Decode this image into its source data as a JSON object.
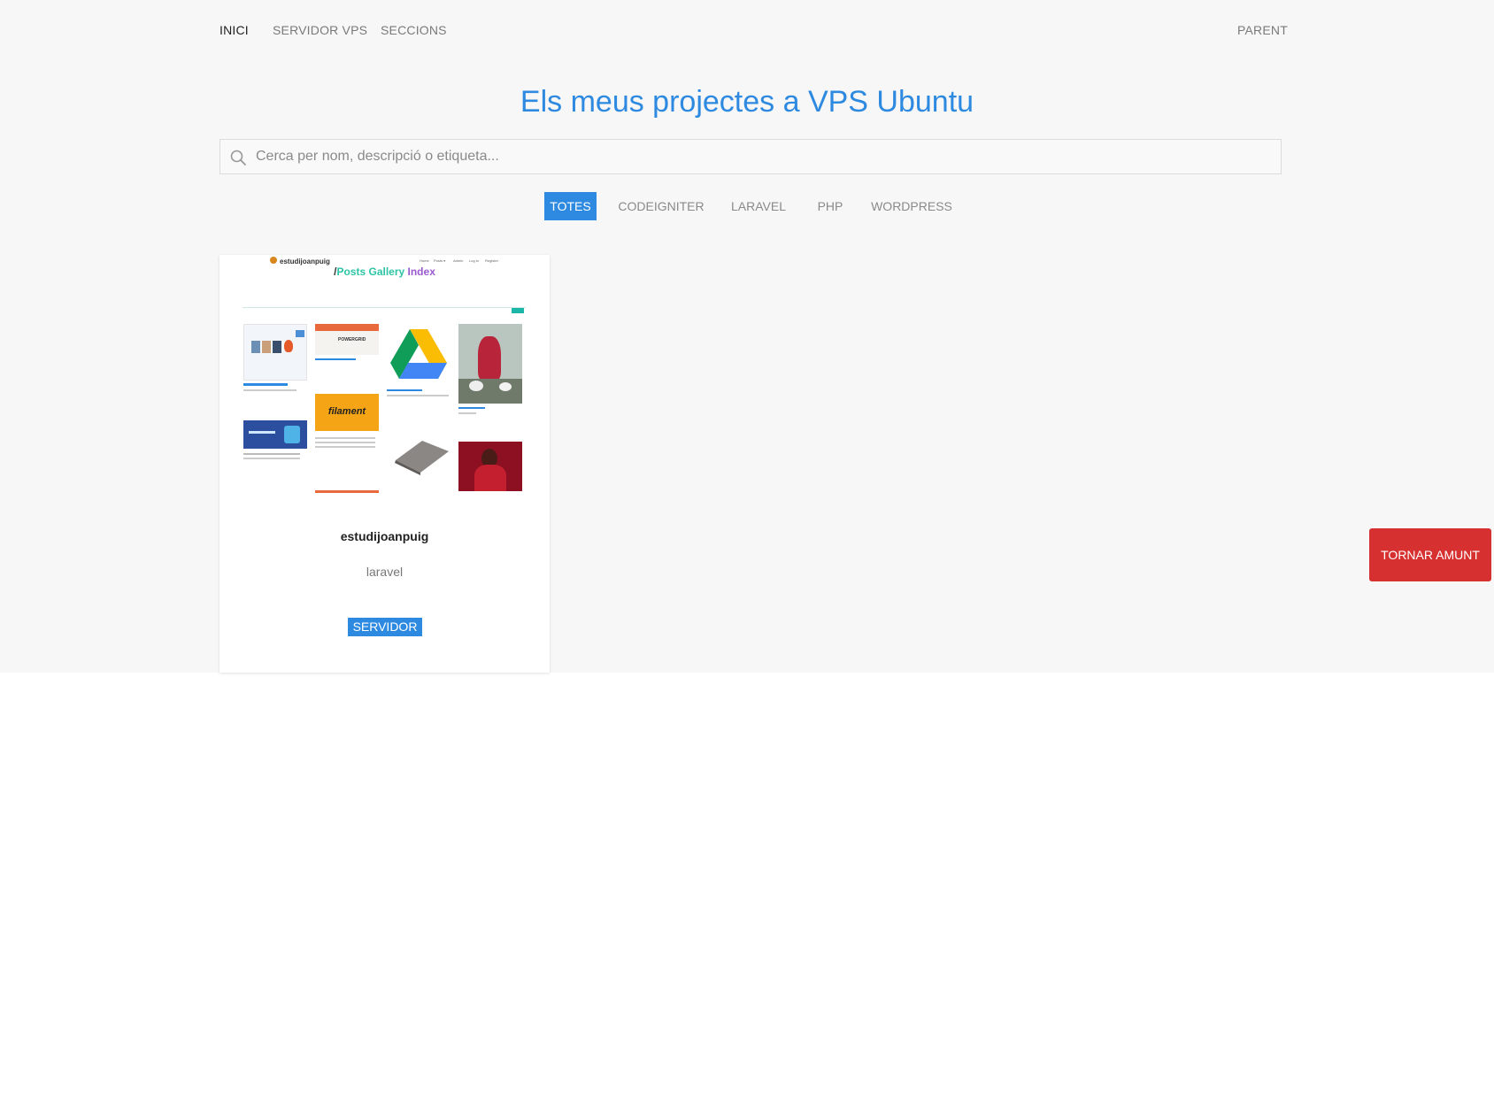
{
  "nav": {
    "items": [
      {
        "label": "INICI",
        "active": true
      },
      {
        "label": "SERVIDOR VPS",
        "active": false
      },
      {
        "label": "SECCIONS",
        "active": false
      }
    ],
    "right_label": "PARENT"
  },
  "page_title": "Els meus projectes a VPS Ubuntu",
  "search": {
    "placeholder": "Cerca per nom, descripció o etiqueta...",
    "value": ""
  },
  "filters": [
    {
      "label": "TOTES",
      "active": true
    },
    {
      "label": "CODEIGNITER",
      "active": false
    },
    {
      "label": "LARAVEL",
      "active": false
    },
    {
      "label": "PHP",
      "active": false
    },
    {
      "label": "WORDPRESS",
      "active": false
    }
  ],
  "projects": [
    {
      "name": "estudijoanpuig",
      "tag": "laravel",
      "button_label": "SERVIDOR",
      "thumbnail": {
        "site_name": "estudijoanpuig",
        "heading_prefix": "/",
        "heading_posts": "Posts Gallery",
        "heading_index": " Index",
        "nav": [
          "Home",
          "Posts ▾",
          "Admin",
          "Log in",
          "Register"
        ],
        "tile_labels": [
          "filament",
          "POWERGRID"
        ]
      }
    }
  ],
  "back_to_top_label": "TORNAR AMUNT",
  "colors": {
    "accent": "#2d8ae0",
    "danger": "#d63031",
    "background": "#f7f7f7"
  }
}
